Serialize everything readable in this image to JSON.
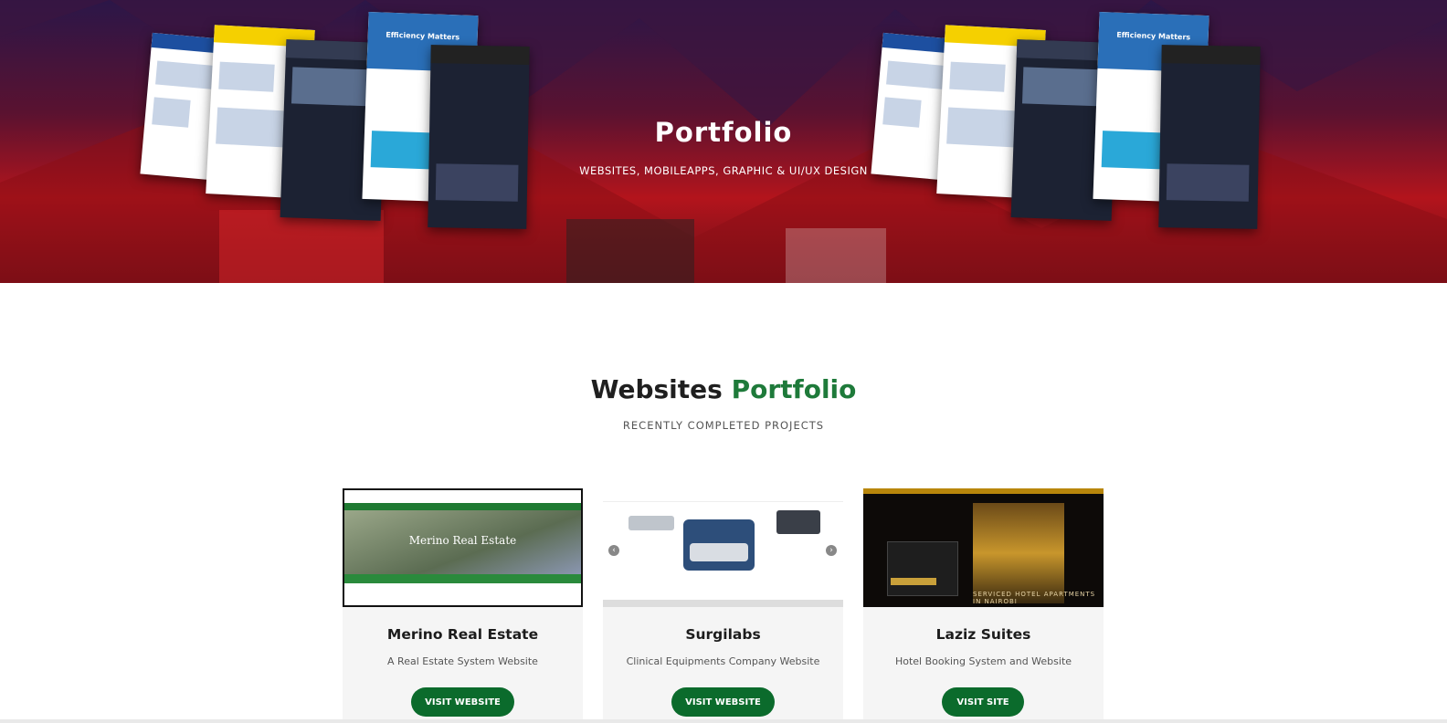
{
  "hero": {
    "title": "Portfolio",
    "subtitle": "WEBSITES, MOBILEAPPS, GRAPHIC & UI/UX DESIGN",
    "mockup_caption": "Efficiency Matters"
  },
  "section": {
    "title_main": "Websites",
    "title_accent": "Portfolio",
    "subtitle": "RECENTLY COMPLETED PROJECTS"
  },
  "cards": [
    {
      "title": "Merino Real Estate",
      "description": "A Real Estate System Website",
      "button": "VISIT WEBSITE",
      "thumb_caption": "Merino Real Estate"
    },
    {
      "title": "Surgilabs",
      "description": "Clinical Equipments Company Website",
      "button": "VISIT WEBSITE"
    },
    {
      "title": "Laziz Suites",
      "description": "Hotel Booking System and Website",
      "button": "VISIT SITE",
      "thumb_caption": "SERVICED HOTEL APARTMENTS IN NAIROBI"
    }
  ],
  "colors": {
    "accent_green": "#1e7a3a",
    "button_green": "#0b6b2c",
    "hero_red": "#b3141c",
    "hero_purple": "#2b1648"
  }
}
